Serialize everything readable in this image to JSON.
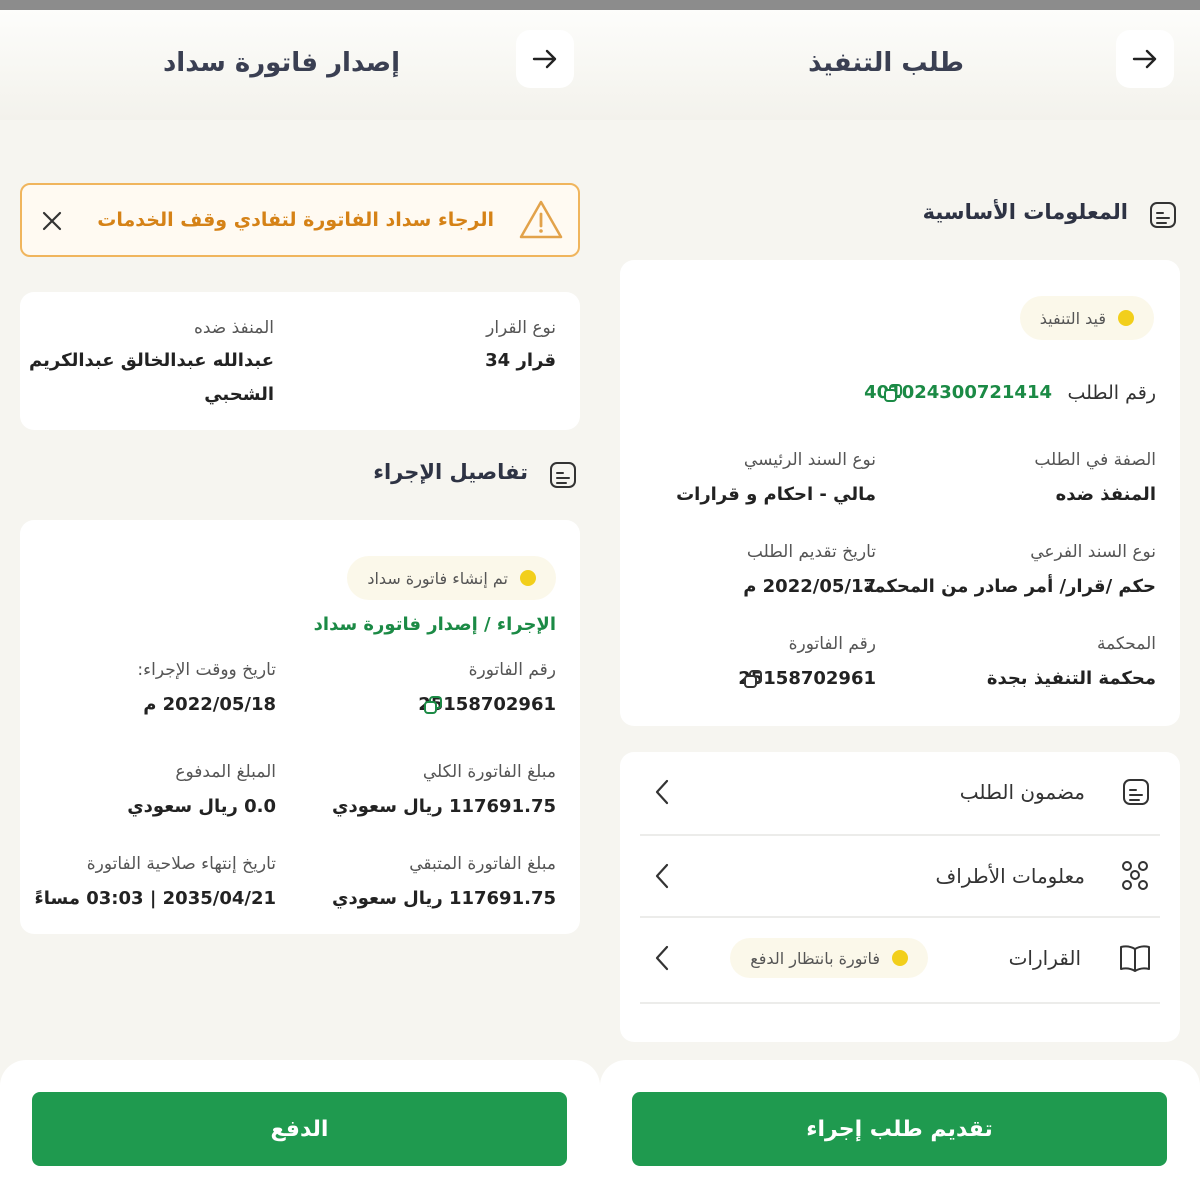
{
  "left": {
    "header": {
      "title": "إصدار فاتورة سداد",
      "back_icon": "arrow-right-icon"
    },
    "alert": {
      "text": "الرجاء سداد الفاتورة لتفادي وقف الخدمات",
      "icon": "warning-triangle-icon",
      "close_icon": "close-icon"
    },
    "summary": {
      "decision_type_label": "نوع القرار",
      "decision_type_value": "قرار 34",
      "executed_against_label": "المنفذ ضده",
      "executed_against_value_line1": "عبدالله عبدالخالق عبدالكريم",
      "executed_against_value_line2": "الشحبي"
    },
    "details": {
      "section_title": "تفاصيل الإجراء",
      "status": "تم إنشاء فاتورة سداد",
      "procedure": "الإجراء / إصدار فاتورة سداد",
      "invoice_number_label": "رقم الفاتورة",
      "invoice_number_value": "25158702961",
      "procedure_date_label": "تاريخ ووقت الإجراء:",
      "procedure_date_value": "2022/05/18 م",
      "total_amount_label": "مبلغ الفاتورة الكلي",
      "total_amount_value": "117691.75 ريال سعودي",
      "paid_amount_label": "المبلغ المدفوع",
      "paid_amount_value": "0.0 ريال سعودي",
      "remaining_amount_label": "مبلغ الفاتورة المتبقي",
      "remaining_amount_value": "117691.75 ريال سعودي",
      "expiry_label": "تاريخ إنتهاء صلاحية الفاتورة",
      "expiry_value": "2035/04/21 | 03:03 مساءً"
    },
    "footer": {
      "pay_button": "الدفع"
    }
  },
  "right": {
    "header": {
      "title": "طلب التنفيذ",
      "back_icon": "arrow-right-icon"
    },
    "basic_info": {
      "section_title": "المعلومات الأساسية",
      "status": "قيد التنفيذ",
      "request_number_label": "رقم الطلب",
      "request_number_value": "401024300721414",
      "role_label": "الصفة في الطلب",
      "role_value": "المنفذ ضده",
      "main_bond_type_label": "نوع السند الرئيسي",
      "main_bond_type_value": "مالي - احكام و قرارات",
      "sub_bond_type_label": "نوع السند الفرعي",
      "sub_bond_type_value": "حكم /قرار/ أمر صادر من المحكمة",
      "submission_date_label": "تاريخ تقديم الطلب",
      "submission_date_value": "2022/05/17 م",
      "court_label": "المحكمة",
      "court_value": "محكمة التنفيذ بجدة",
      "invoice_number_label": "رقم الفاتورة",
      "invoice_number_value": "25158702961"
    },
    "list": [
      {
        "label": "مضمون الطلب",
        "icon": "document-icon"
      },
      {
        "label": "معلومات الأطراف",
        "icon": "people-icon"
      },
      {
        "label": "القرارات",
        "icon": "book-icon",
        "badge": "فاتورة بانتظار الدفع"
      }
    ],
    "footer": {
      "submit_button": "تقديم طلب إجراء"
    }
  },
  "colors": {
    "primary": "#1f9a4f",
    "accent_green_text": "#1b8a45",
    "warning": "#d58217",
    "status_dot": "#f2cf1b"
  }
}
